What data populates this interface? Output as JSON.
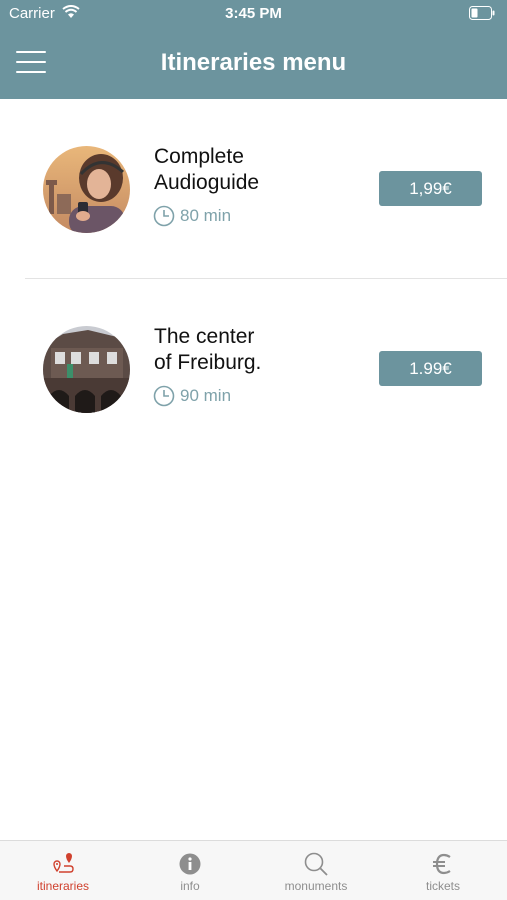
{
  "status_bar": {
    "carrier": "Carrier",
    "time": "3:45 PM"
  },
  "header": {
    "title": "Itineraries menu"
  },
  "itineraries": [
    {
      "title_lines": [
        "Complete",
        "Audioguide"
      ],
      "duration": "80 min",
      "price": "1,99€"
    },
    {
      "title_lines": [
        "The center",
        "of Freiburg."
      ],
      "duration": "90 min",
      "price": "1.99€"
    }
  ],
  "tab_bar": {
    "tabs": [
      {
        "label": "itineraries",
        "icon": "route-pin-icon",
        "active": true
      },
      {
        "label": "info",
        "icon": "info-icon",
        "active": false
      },
      {
        "label": "monuments",
        "icon": "search-icon",
        "active": false
      },
      {
        "label": "tickets",
        "icon": "euro-icon",
        "active": false
      }
    ]
  },
  "colors": {
    "header": "#6c949e",
    "accent_active": "#d0412e",
    "duration_text": "#7fa2aa"
  }
}
